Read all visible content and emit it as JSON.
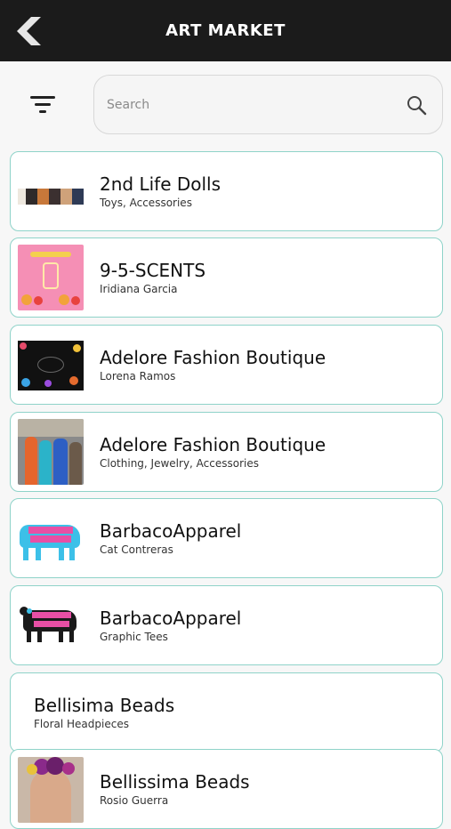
{
  "header": {
    "title": "ART MARKET",
    "background": "#1b1b1b"
  },
  "search": {
    "placeholder": "Search",
    "value": ""
  },
  "accent_color": "#8fd3c9",
  "vendors": [
    {
      "name": "2nd Life Dolls",
      "subtitle": "Toys, Accessories",
      "thumbnail": "dolls-strip-photo"
    },
    {
      "name": "9-5-SCENTS",
      "subtitle": "Iridiana Garcia",
      "thumbnail": "pink-candle-logo"
    },
    {
      "name": "Adelore Fashion Boutique",
      "subtitle": "Lorena Ramos",
      "thumbnail": "floral-black-logo"
    },
    {
      "name": "Adelore Fashion Boutique",
      "subtitle": "Clothing, Jewelry, Accessories",
      "thumbnail": "people-booth-photo"
    },
    {
      "name": "BarbacoApparel",
      "subtitle": "Cat Contreras",
      "thumbnail": "blue-cow-logo"
    },
    {
      "name": "BarbacoApparel",
      "subtitle": "Graphic Tees",
      "thumbnail": "black-cow-logo"
    },
    {
      "name": "Bellisima Beads",
      "subtitle": "Floral Headpieces",
      "thumbnail": ""
    },
    {
      "name": "Bellissima Beads",
      "subtitle": "Rosio Guerra",
      "thumbnail": "flower-crown-photo"
    }
  ]
}
